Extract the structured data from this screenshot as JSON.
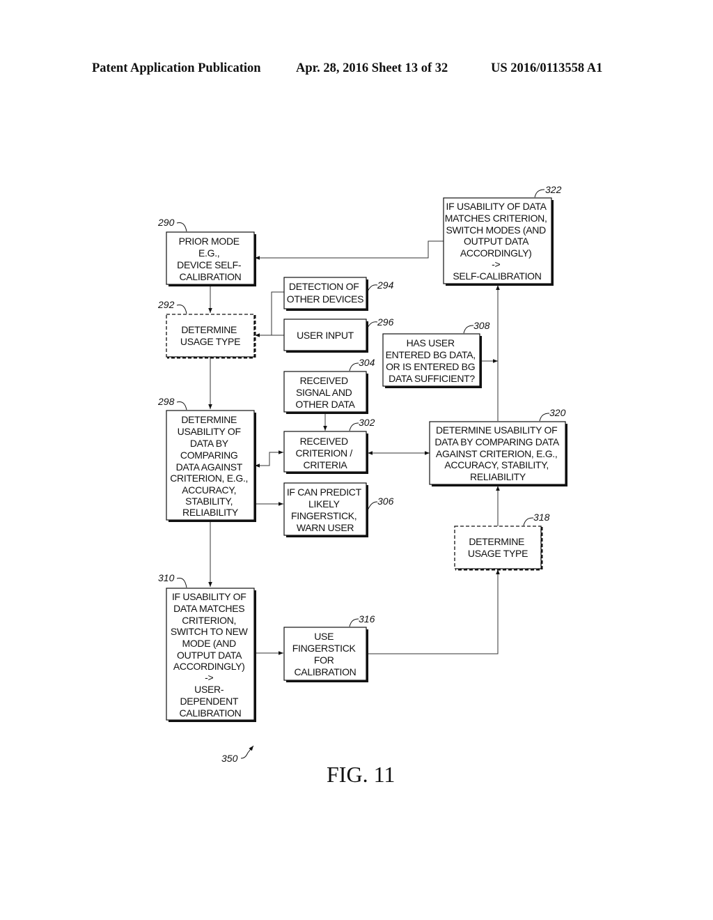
{
  "header": {
    "publication": "Patent Application Publication",
    "date_sheet": "Apr. 28, 2016  Sheet 13 of 32",
    "number": "US 2016/0113558 A1"
  },
  "figure": {
    "caption": "FIG. 11",
    "overall_ref": "350",
    "boxes": [
      {
        "id": "290",
        "ref": "290",
        "style": "solid",
        "lines": [
          "PRIOR MODE",
          "E.G.,",
          "DEVICE SELF-",
          "CALIBRATION"
        ]
      },
      {
        "id": "292",
        "ref": "292",
        "style": "dashed",
        "lines": [
          "DETERMINE",
          "USAGE TYPE"
        ]
      },
      {
        "id": "294",
        "ref": "294",
        "style": "solid",
        "lines": [
          "DETECTION OF",
          "OTHER DEVICES"
        ]
      },
      {
        "id": "296",
        "ref": "296",
        "style": "solid",
        "lines": [
          "USER INPUT"
        ]
      },
      {
        "id": "298",
        "ref": "298",
        "style": "solid",
        "lines": [
          "DETERMINE",
          "USABILITY OF",
          "DATA BY",
          "COMPARING",
          "DATA AGAINST",
          "CRITERION, E.G.,",
          "ACCURACY,",
          "STABILITY,",
          "RELIABILITY"
        ]
      },
      {
        "id": "302",
        "ref": "302",
        "style": "solid",
        "lines": [
          "RECEIVED",
          "CRITERION /",
          "CRITERIA"
        ]
      },
      {
        "id": "304",
        "ref": "304",
        "style": "solid",
        "lines": [
          "RECEIVED",
          "SIGNAL AND",
          "OTHER DATA"
        ]
      },
      {
        "id": "306",
        "ref": "306",
        "style": "solid",
        "lines": [
          "IF CAN PREDICT",
          "LIKELY",
          "FINGERSTICK,",
          "WARN USER"
        ]
      },
      {
        "id": "308",
        "ref": "308",
        "style": "solid",
        "lines": [
          "HAS USER",
          "ENTERED BG DATA,",
          "OR IS ENTERED BG",
          "DATA SUFFICIENT?"
        ]
      },
      {
        "id": "310",
        "ref": "310",
        "style": "solid",
        "lines": [
          "IF USABILITY OF",
          "DATA MATCHES",
          "CRITERION,",
          "SWITCH TO NEW",
          "MODE (AND",
          "OUTPUT DATA",
          "ACCORDINGLY)",
          "->",
          "USER-",
          "DEPENDENT",
          "CALIBRATION"
        ]
      },
      {
        "id": "316",
        "ref": "316",
        "style": "solid",
        "lines": [
          "USE",
          "FINGERSTICK",
          "FOR",
          "CALIBRATION"
        ]
      },
      {
        "id": "318",
        "ref": "318",
        "style": "dashed",
        "lines": [
          "DETERMINE",
          "USAGE TYPE"
        ]
      },
      {
        "id": "320",
        "ref": "320",
        "style": "solid",
        "lines": [
          "DETERMINE USABILITY OF",
          "DATA BY COMPARING DATA",
          "AGAINST CRITERION, E.G.,",
          "ACCURACY, STABILITY,",
          "RELIABILITY"
        ]
      },
      {
        "id": "322",
        "ref": "322",
        "style": "solid",
        "lines": [
          "IF USABILITY OF DATA",
          "MATCHES CRITERION,",
          "SWITCH MODES (AND",
          "OUTPUT DATA",
          "ACCORDINGLY)",
          "->",
          "SELF-CALIBRATION"
        ]
      }
    ],
    "connections": [
      {
        "from": "290",
        "to": "292"
      },
      {
        "from": "294",
        "to": "292"
      },
      {
        "from": "296",
        "to": "292"
      },
      {
        "from": "292",
        "to": "298"
      },
      {
        "from": "304",
        "to": "302"
      },
      {
        "from": "298",
        "to": "302",
        "bidirectional": true
      },
      {
        "from": "302",
        "to": "320",
        "bidirectional": true
      },
      {
        "from": "298",
        "to": "306"
      },
      {
        "from": "298",
        "to": "310"
      },
      {
        "from": "310",
        "to": "316"
      },
      {
        "from": "316",
        "to": "318"
      },
      {
        "from": "318",
        "to": "320"
      },
      {
        "from": "320",
        "to": "322"
      },
      {
        "from": "308",
        "to": "322"
      },
      {
        "from": "322",
        "to": "290"
      }
    ]
  }
}
